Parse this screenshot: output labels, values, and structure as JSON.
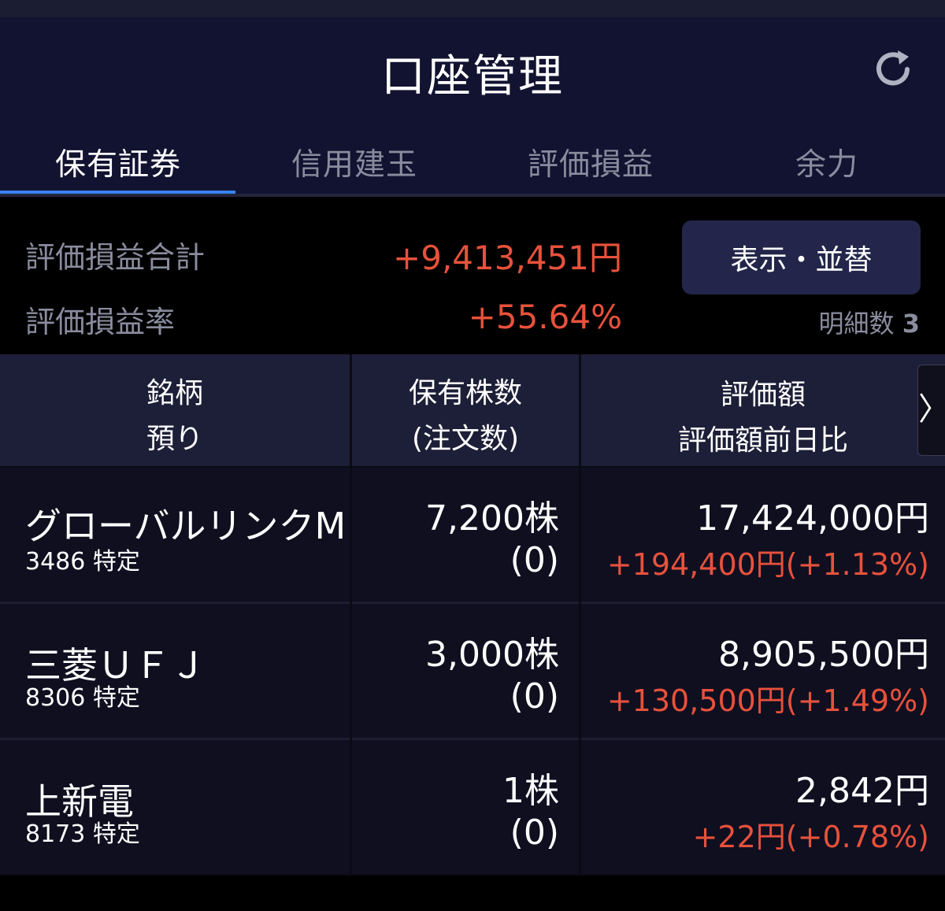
{
  "header": {
    "title": "口座管理",
    "refresh_icon": "refresh-icon"
  },
  "tabs": [
    {
      "label": "保有証券",
      "active": true
    },
    {
      "label": "信用建玉",
      "active": false
    },
    {
      "label": "評価損益",
      "active": false
    },
    {
      "label": "余力",
      "active": false
    }
  ],
  "summary": {
    "total_label": "評価損益合計",
    "total_value": "+9,413,451円",
    "rate_label": "評価損益率",
    "rate_value": "+55.64%",
    "sort_button": "表示・並替",
    "count_label": "明細数",
    "count_value": "3"
  },
  "table_header": {
    "col1_line1": "銘柄",
    "col1_line2": "預り",
    "col2_line1": "保有株数",
    "col2_line2": "(注文数)",
    "col3_line1": "評価額",
    "col3_line2": "評価額前日比",
    "next_icon": "〉"
  },
  "rows": [
    {
      "name": "グローバルリンクM",
      "code": "3486 特定",
      "shares": "7,200株",
      "orders": "(0)",
      "value": "17,424,000円",
      "change": "+194,400円(+1.13%)"
    },
    {
      "name": "三菱ＵＦＪ",
      "code": "8306 特定",
      "shares": "3,000株",
      "orders": "(0)",
      "value": "8,905,500円",
      "change": "+130,500円(+1.49%)"
    },
    {
      "name": "上新電",
      "code": "8173 特定",
      "shares": "1株",
      "orders": "(0)",
      "value": "2,842円",
      "change": "+22円(+0.78%)"
    }
  ],
  "colors": {
    "accent": "#3a82f2",
    "positive": "#e8513b",
    "header_bg": "#121331"
  }
}
